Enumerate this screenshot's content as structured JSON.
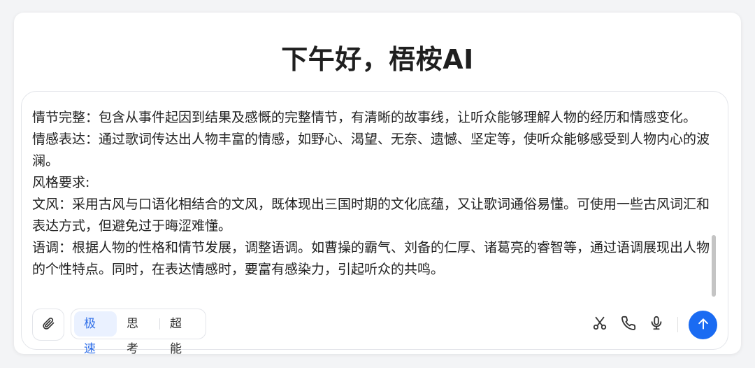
{
  "header": {
    "greeting": "下午好，梧桉AI"
  },
  "composer": {
    "lines": [
      "情节完整：包含从事件起因到结果及感慨的完整情节，有清晰的故事线，让听众能够理解人物的经历和情感变化。",
      "情感表达：通过歌词传达出人物丰富的情感，如野心、渴望、无奈、遗憾、坚定等，使听众能够感受到人物内心的波澜。",
      "风格要求:",
      "文风：采用古风与口语化相结合的文风，既体现出三国时期的文化底蕴，又让歌词通俗易懂。可使用一些古风词汇和表达方式，但避免过于晦涩难懂。",
      "语调：根据人物的性格和情节发展，调整语调。如曹操的霸气、刘备的仁厚、诸葛亮的睿智等，通过语调展现出人物的个性特点。同时，在表达情感时，要富有感染力，引起听众的共鸣。"
    ]
  },
  "toolbar": {
    "modes": [
      "极速",
      "思考",
      "超能"
    ],
    "active_mode": "极速",
    "icons": {
      "attach": "paperclip-icon",
      "cut": "scissors-icon",
      "call": "phone-icon",
      "voice": "microphone-icon",
      "send": "arrow-up-icon"
    }
  },
  "colors": {
    "accent": "#1a6bf2",
    "active_mode_bg": "#eaf1ff",
    "active_mode_text": "#2f6ee8"
  }
}
